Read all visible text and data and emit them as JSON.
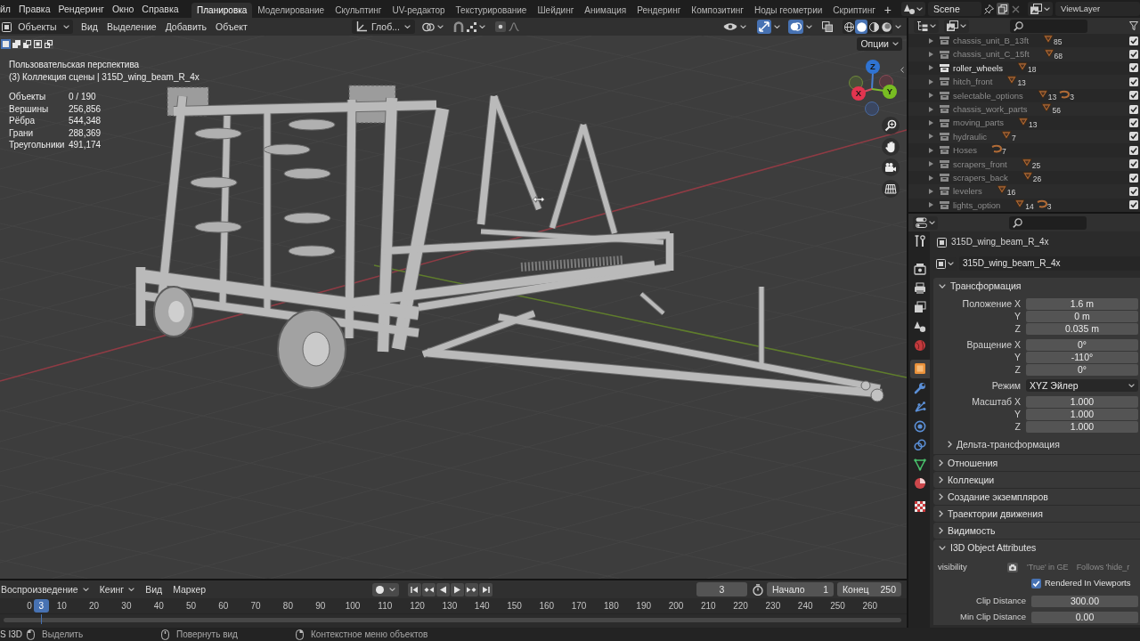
{
  "topbar": {
    "menus": [
      "йл",
      "Правка",
      "Рендеринг",
      "Окно",
      "Справка"
    ],
    "workspaces": [
      {
        "label": "Планировка",
        "selected": true
      },
      {
        "label": "Моделирование",
        "selected": false
      },
      {
        "label": "Скульптинг",
        "selected": false
      },
      {
        "label": "UV-редактор",
        "selected": false
      },
      {
        "label": "Текстурирование",
        "selected": false
      },
      {
        "label": "Шейдинг",
        "selected": false
      },
      {
        "label": "Анимация",
        "selected": false
      },
      {
        "label": "Рендеринг",
        "selected": false
      },
      {
        "label": "Композитинг",
        "selected": false
      },
      {
        "label": "Ноды геометрии",
        "selected": false
      },
      {
        "label": "Скриптинг",
        "selected": false
      }
    ],
    "add_workspace": "+",
    "scene": "Scene",
    "view_layer": "ViewLayer"
  },
  "viewport": {
    "header": {
      "mode": "Объекты",
      "menus": [
        "Вид",
        "Выделение",
        "Добавить",
        "Объект"
      ],
      "orientation": "Глоб...",
      "toggles": [
        {
          "kind": "gizmos",
          "on": true
        },
        {
          "kind": "overlays",
          "on": true
        },
        {
          "kind": "xray",
          "on": false
        }
      ],
      "shading": [
        {
          "kind": "wireframe",
          "selected": false
        },
        {
          "kind": "solid",
          "selected": true
        },
        {
          "kind": "material",
          "selected": false
        },
        {
          "kind": "rendered",
          "selected": false
        }
      ]
    },
    "select_modes": [
      {
        "kind": "set",
        "selected": true
      },
      {
        "kind": "extend",
        "selected": false
      },
      {
        "kind": "subtract",
        "selected": false
      },
      {
        "kind": "invert",
        "selected": false
      },
      {
        "kind": "intersect",
        "selected": false
      }
    ],
    "options": "Опции",
    "view_name": "Пользовательская перспектива",
    "context": "(3) Коллекция сцены | 315D_wing_beam_R_4x",
    "stats": [
      {
        "label": "Объекты",
        "value": "0 / 190"
      },
      {
        "label": "Вершины",
        "value": "256,856"
      },
      {
        "label": "Рёбра",
        "value": "544,348"
      },
      {
        "label": "Грани",
        "value": "288,369"
      },
      {
        "label": "Треугольники",
        "value": "491,174"
      }
    ],
    "axes": [
      {
        "label": "Z",
        "color": "#2f73d2"
      },
      {
        "label": "X",
        "color": "#e2344f"
      },
      {
        "label": "Y",
        "color": "#78bd22"
      }
    ]
  },
  "outliner": {
    "rows": [
      {
        "name": "chassis_unit_B_13ft",
        "dimmed": true,
        "checked": true,
        "counts": [
          {
            "kind": "mesh",
            "count": "85"
          }
        ]
      },
      {
        "name": "chassis_unit_C_15ft",
        "dimmed": true,
        "checked": true,
        "counts": [
          {
            "kind": "mesh",
            "count": "68"
          }
        ]
      },
      {
        "name": "roller_wheels",
        "dimmed": false,
        "checked": true,
        "counts": [
          {
            "kind": "mesh",
            "count": "18"
          }
        ]
      },
      {
        "name": "hitch_front",
        "dimmed": true,
        "checked": true,
        "counts": [
          {
            "kind": "mesh",
            "count": "13"
          }
        ]
      },
      {
        "name": "selectable_options",
        "dimmed": true,
        "checked": true,
        "counts": [
          {
            "kind": "mesh",
            "count": "13"
          },
          {
            "kind": "curve",
            "count": "3"
          }
        ]
      },
      {
        "name": "chassis_work_parts",
        "dimmed": true,
        "checked": true,
        "counts": [
          {
            "kind": "mesh",
            "count": "56"
          }
        ]
      },
      {
        "name": "moving_parts",
        "dimmed": true,
        "checked": true,
        "counts": [
          {
            "kind": "mesh",
            "count": "13"
          }
        ]
      },
      {
        "name": "hydraulic",
        "dimmed": true,
        "checked": true,
        "counts": [
          {
            "kind": "mesh",
            "count": "7"
          }
        ]
      },
      {
        "name": "Hoses",
        "dimmed": true,
        "checked": true,
        "counts": [
          {
            "kind": "curve",
            "count": "7"
          }
        ]
      },
      {
        "name": "scrapers_front",
        "dimmed": true,
        "checked": true,
        "counts": [
          {
            "kind": "mesh",
            "count": "25"
          }
        ]
      },
      {
        "name": "scrapers_back",
        "dimmed": true,
        "checked": true,
        "counts": [
          {
            "kind": "mesh",
            "count": "26"
          }
        ]
      },
      {
        "name": "levelers",
        "dimmed": true,
        "checked": true,
        "counts": [
          {
            "kind": "mesh",
            "count": "16"
          }
        ]
      },
      {
        "name": "lights_option",
        "dimmed": true,
        "checked": true,
        "counts": [
          {
            "kind": "mesh",
            "count": "14"
          },
          {
            "kind": "curve",
            "count": "3"
          }
        ]
      }
    ]
  },
  "properties": {
    "tabs": [
      {
        "kind": "tool",
        "selected": false
      },
      {
        "kind": "render",
        "selected": false
      },
      {
        "kind": "output",
        "selected": false
      },
      {
        "kind": "view_layer",
        "selected": false
      },
      {
        "kind": "scene",
        "selected": false
      },
      {
        "kind": "world",
        "selected": false
      },
      {
        "kind": "object",
        "selected": true
      },
      {
        "kind": "modifiers",
        "selected": false
      },
      {
        "kind": "particles",
        "selected": false
      },
      {
        "kind": "physics",
        "selected": false
      },
      {
        "kind": "constraints",
        "selected": false
      },
      {
        "kind": "data",
        "selected": false
      },
      {
        "kind": "material",
        "selected": false
      },
      {
        "kind": "texture",
        "selected": false
      }
    ],
    "object_name": "315D_wing_beam_R_4x",
    "data_name": "315D_wing_beam_R_4x",
    "panels": [
      {
        "kind": "transform",
        "title": "Трансформация",
        "expanded": true,
        "groups": [
          {
            "rows": [
              {
                "kind": "number",
                "label": "Положение X",
                "value": "1.6 m"
              },
              {
                "kind": "number",
                "label": "Y",
                "value": "0 m"
              },
              {
                "kind": "number",
                "label": "Z",
                "value": "0.035 m"
              }
            ]
          },
          {
            "rows": [
              {
                "kind": "number",
                "label": "Вращение X",
                "value": "0°"
              },
              {
                "kind": "number",
                "label": "Y",
                "value": "-110°"
              },
              {
                "kind": "number",
                "label": "Z",
                "value": "0°"
              }
            ]
          },
          {
            "rows": [
              {
                "kind": "dropdown",
                "label": "Режим",
                "value": "XYZ Эйлер"
              }
            ]
          },
          {
            "rows": [
              {
                "kind": "number",
                "label": "Масштаб X",
                "value": "1.000"
              },
              {
                "kind": "number",
                "label": "Y",
                "value": "1.000"
              },
              {
                "kind": "number",
                "label": "Z",
                "value": "1.000"
              }
            ]
          }
        ],
        "subpanels": [
          {
            "title": "Дельта-трансформация",
            "expanded": false
          }
        ]
      },
      {
        "kind": "plain",
        "title": "Отношения",
        "expanded": false
      },
      {
        "kind": "plain",
        "title": "Коллекции",
        "expanded": false
      },
      {
        "kind": "plain",
        "title": "Создание экземпляров",
        "expanded": false
      },
      {
        "kind": "plain",
        "title": "Траектории движения",
        "expanded": false
      },
      {
        "kind": "plain",
        "title": "Видимость",
        "expanded": false
      },
      {
        "kind": "i3d",
        "title": "I3D Object Attributes",
        "expanded": true,
        "visibility": {
          "label": "visibility",
          "hint": "'True' in GE",
          "note": "Follows 'hide_r"
        },
        "rendered_in_viewports": {
          "label": "Rendered In Viewports",
          "checked": true
        },
        "fields": [
          {
            "label": "Clip Distance",
            "value": "300.00"
          },
          {
            "label": "Min Clip Distance",
            "value": "0.00"
          }
        ]
      }
    ]
  },
  "timeline": {
    "menus": [
      {
        "label": "Воспроизведение",
        "kind": "dropdown"
      },
      {
        "label": "Кеинг",
        "kind": "dropdown"
      },
      {
        "label": "Вид",
        "kind": "menu"
      },
      {
        "label": "Маркер",
        "kind": "menu"
      }
    ],
    "current_frame": "3",
    "start_label": "Начало",
    "start": "1",
    "end_label": "Конец",
    "end": "250",
    "ruler": [
      "0",
      "10",
      "20",
      "30",
      "40",
      "50",
      "60",
      "70",
      "80",
      "90",
      "100",
      "110",
      "120",
      "130",
      "140",
      "150",
      "160",
      "170",
      "180",
      "190",
      "200",
      "210",
      "220",
      "230",
      "240",
      "250",
      "260"
    ],
    "playhead": "3"
  },
  "status_bar": {
    "workspace": "S I3D",
    "hints": [
      {
        "kind": "left",
        "label": "Выделить"
      },
      {
        "kind": "middle",
        "label": "Повернуть вид"
      },
      {
        "kind": "right",
        "label": "Контекстное меню объектов"
      }
    ]
  }
}
